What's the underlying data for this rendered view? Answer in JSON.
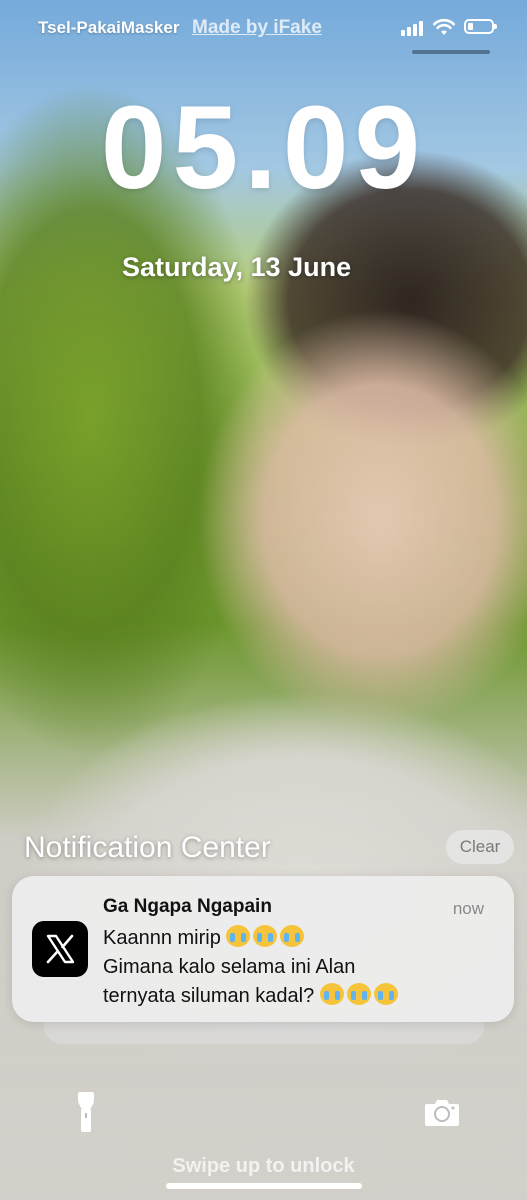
{
  "status_bar": {
    "carrier": "Tsel-PakaiMasker",
    "watermark": "Made by iFake",
    "signal_icon": "cellular-signal-icon",
    "wifi_icon": "wifi-icon",
    "battery_icon": "battery-icon"
  },
  "lockscreen": {
    "time": "05.09",
    "date": "Saturday, 13 June"
  },
  "notification_center": {
    "title": "Notification Center",
    "clear_label": "Clear",
    "notifications": [
      {
        "app_icon": "x-logo-icon",
        "title": "Ga Ngapa Ngapain",
        "time": "now",
        "line1": "Kaannn mirip",
        "line2": "Gimana kalo selama ini Alan",
        "line3": "ternyata siluman kadal?",
        "emoji": "loudly-crying-face",
        "emoji_count": 3
      }
    ]
  },
  "bottom": {
    "flashlight_icon": "flashlight-icon",
    "camera_icon": "camera-icon",
    "swipe_text": "Swipe up to unlock"
  },
  "colors": {
    "notification_bg": "#ececec",
    "text_white": "#ffffff",
    "muted": "#8a8a8a"
  }
}
